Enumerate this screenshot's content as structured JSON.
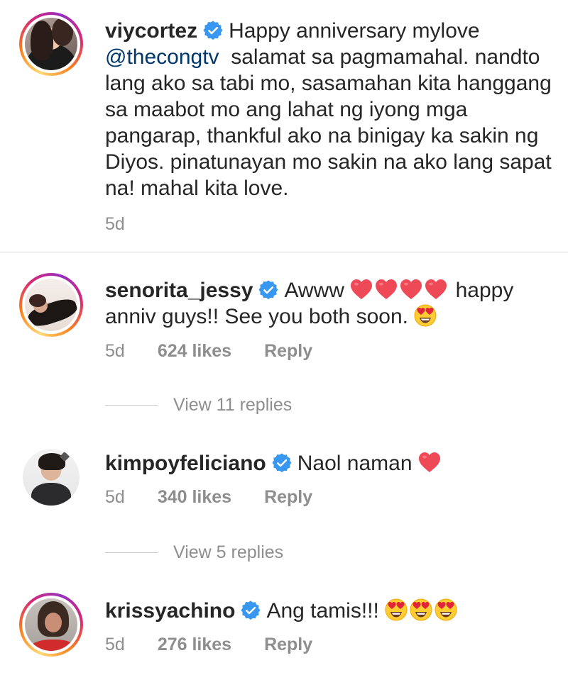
{
  "colors": {
    "text": "#262626",
    "muted": "#8e8e8e",
    "mention": "#00376b",
    "verified": "#3897f0",
    "heart": "#ed4956",
    "divider": "#dbdbdb"
  },
  "main_comment": {
    "username": "viycortez",
    "text_before_mention": "Happy anniversary mylove",
    "mention": "@thecongtv",
    "text_after_mention": "salamat sa pagmamahal. nandto lang ako sa tabi mo, sasamahan kita hanggang sa maabot mo ang lahat ng iyong mga pangarap, thankful ako na binigay ka sakin ng Diyos. pinatunayan mo sakin na ako lang sapat na!  mahal kita love.",
    "time": "5d"
  },
  "comments": [
    {
      "username": "senorita_jessy",
      "text_a": "Awww",
      "emojis_a": [
        "red-heart-emoji",
        "red-heart-emoji",
        "red-heart-emoji",
        "red-heart-emoji"
      ],
      "text_b": "happy anniv guys!! See you both soon.",
      "emojis_b": [
        "heart-eyes-emoji"
      ],
      "time": "5d",
      "likes": "624 likes",
      "reply": "Reply",
      "view_replies": "View 11 replies"
    },
    {
      "username": "kimpoyfeliciano",
      "text_a": "Naol naman",
      "emojis_a": [
        "red-heart-emoji"
      ],
      "time": "5d",
      "likes": "340 likes",
      "reply": "Reply",
      "view_replies": "View 5 replies"
    },
    {
      "username": "krissyachino",
      "text_a": "Ang tamis!!!",
      "emojis_a": [
        "heart-eyes-emoji",
        "heart-eyes-emoji",
        "heart-eyes-emoji"
      ],
      "time": "5d",
      "likes": "276 likes",
      "reply": "Reply"
    }
  ]
}
